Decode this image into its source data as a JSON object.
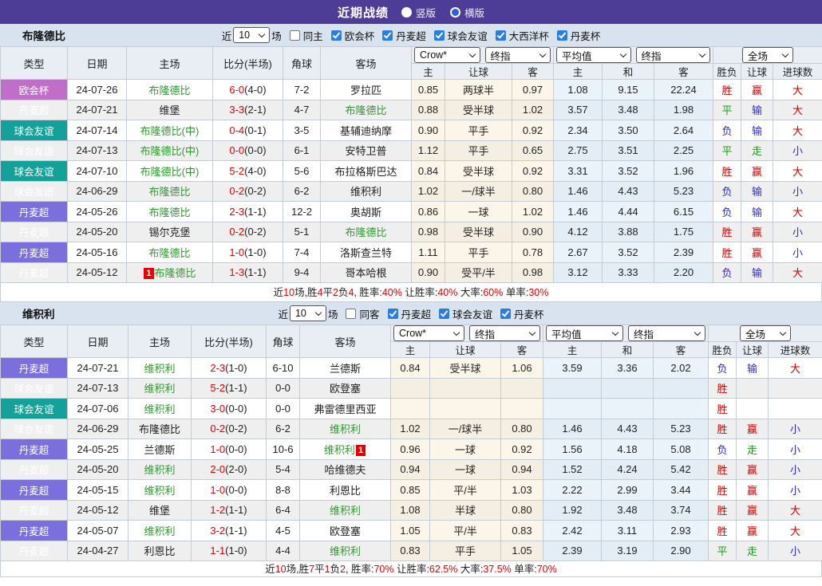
{
  "topbar": {
    "title": "近期战绩",
    "radios": [
      {
        "label": "竖版",
        "variant": "solid"
      },
      {
        "label": "横版",
        "variant": "dot"
      }
    ]
  },
  "colors": {
    "topbar_bg": "#4e3d96",
    "sectionbar_bg": "#d9e3ef",
    "header_bg": "#e9edf4",
    "border_c": "#c6ccd6",
    "badge_cup": "#c06fc8",
    "badge_super": "#7b6fde",
    "badge_friendly": "#13a19a",
    "team_green": "#2f9b2f",
    "score_red": "#e60000",
    "res_red": "#d30000",
    "res_blue": "#2b2bd5",
    "res_green": "#18a018",
    "row_alt": "#efefef",
    "odds_bg": "#fcf6ea",
    "odds_bg_alt": "#f5efe3",
    "avg_bg": "#eaf3fa",
    "avg_bg_alt": "#e3edf5",
    "accent_blue": "#2a7de1",
    "radio_dot": "#2a62d8",
    "summary_red": "#e60000",
    "card_red": "#e60000"
  },
  "league_class": {
    "欧会杯": "cup",
    "丹麦超": "super",
    "球会友谊": "friendly"
  },
  "result_color_map": {
    "胜": "red",
    "平": "green",
    "负": "blue",
    "赢": "red",
    "输": "blue",
    "走": "green",
    "大": "red",
    "小": "blue"
  },
  "sections": [
    {
      "team": "布隆德比",
      "filter": {
        "prefix": "近",
        "count": "10",
        "suffix": "场",
        "venue": {
          "label": "同主",
          "checked": false
        },
        "leagues": [
          {
            "label": "欧会杯",
            "checked": true
          },
          {
            "label": "丹麦超",
            "checked": true
          },
          {
            "label": "球会友谊",
            "checked": true
          },
          {
            "label": "大西洋杯",
            "checked": true
          },
          {
            "label": "丹麦杯",
            "checked": true
          }
        ]
      },
      "header": {
        "left_cols": [
          "类型",
          "日期",
          "主场",
          "比分(半场)",
          "角球",
          "客场"
        ],
        "odds_selects": [
          "Crow*",
          "终指"
        ],
        "avg_selects": [
          "平均值",
          "终指"
        ],
        "scope_select": "全场",
        "sub_cols": [
          "主",
          "让球",
          "客",
          "主",
          "和",
          "客",
          "胜负",
          "让球",
          "进球数"
        ]
      },
      "rows": [
        {
          "league": "欧会杯",
          "date": "24-07-26",
          "home": {
            "name": "布隆德比",
            "green": true
          },
          "score": "6-0",
          "half": "(4-0)",
          "corners": "7-2",
          "away": {
            "name": "罗拉匹",
            "green": false
          },
          "odds": [
            "0.85",
            "两球半",
            "0.97"
          ],
          "avg": [
            "1.08",
            "9.15",
            "22.24"
          ],
          "results": [
            "胜",
            "赢",
            "大"
          ]
        },
        {
          "league": "丹麦超",
          "date": "24-07-21",
          "home": {
            "name": "维堡",
            "green": false
          },
          "score": "3-3",
          "half": "(2-1)",
          "corners": "4-7",
          "away": {
            "name": "布隆德比",
            "green": true
          },
          "odds": [
            "0.88",
            "受半球",
            "1.02"
          ],
          "avg": [
            "3.57",
            "3.48",
            "1.98"
          ],
          "results": [
            "平",
            "输",
            "大"
          ]
        },
        {
          "league": "球会友谊",
          "date": "24-07-14",
          "home": {
            "name": "布隆德比(中)",
            "green": true
          },
          "score": "0-4",
          "half": "(0-1)",
          "corners": "3-5",
          "away": {
            "name": "基辅迪纳摩",
            "green": false
          },
          "odds": [
            "0.90",
            "平手",
            "0.92"
          ],
          "avg": [
            "2.34",
            "3.50",
            "2.64"
          ],
          "results": [
            "负",
            "输",
            "大"
          ]
        },
        {
          "league": "球会友谊",
          "date": "24-07-13",
          "home": {
            "name": "布隆德比(中)",
            "green": true
          },
          "score": "0-0",
          "half": "(0-0)",
          "corners": "6-1",
          "away": {
            "name": "安特卫普",
            "green": false
          },
          "odds": [
            "1.12",
            "平手",
            "0.65"
          ],
          "avg": [
            "2.75",
            "3.51",
            "2.25"
          ],
          "results": [
            "平",
            "走",
            "小"
          ]
        },
        {
          "league": "球会友谊",
          "date": "24-07-10",
          "home": {
            "name": "布隆德比(中)",
            "green": true
          },
          "score": "5-2",
          "half": "(4-0)",
          "corners": "5-6",
          "away": {
            "name": "布拉格斯巴达",
            "green": false
          },
          "odds": [
            "0.84",
            "受半球",
            "0.92"
          ],
          "avg": [
            "3.31",
            "3.52",
            "1.96"
          ],
          "results": [
            "胜",
            "赢",
            "大"
          ]
        },
        {
          "league": "球会友谊",
          "date": "24-06-29",
          "home": {
            "name": "布隆德比",
            "green": true
          },
          "score": "0-2",
          "half": "(0-2)",
          "corners": "6-2",
          "away": {
            "name": "维积利",
            "green": false
          },
          "odds": [
            "1.02",
            "一/球半",
            "0.80"
          ],
          "avg": [
            "1.46",
            "4.43",
            "5.23"
          ],
          "results": [
            "负",
            "输",
            "小"
          ]
        },
        {
          "league": "丹麦超",
          "date": "24-05-26",
          "home": {
            "name": "布隆德比",
            "green": true
          },
          "score": "2-3",
          "half": "(1-1)",
          "corners": "12-2",
          "away": {
            "name": "奥胡斯",
            "green": false
          },
          "odds": [
            "0.86",
            "一球",
            "1.02"
          ],
          "avg": [
            "1.46",
            "4.44",
            "6.15"
          ],
          "results": [
            "负",
            "输",
            "大"
          ]
        },
        {
          "league": "丹麦超",
          "date": "24-05-20",
          "home": {
            "name": "锡尔克堡",
            "green": false
          },
          "score": "0-2",
          "half": "(0-2)",
          "corners": "5-1",
          "away": {
            "name": "布隆德比",
            "green": true
          },
          "odds": [
            "0.98",
            "受半球",
            "0.90"
          ],
          "avg": [
            "4.12",
            "3.88",
            "1.75"
          ],
          "results": [
            "胜",
            "赢",
            "小"
          ]
        },
        {
          "league": "丹麦超",
          "date": "24-05-16",
          "home": {
            "name": "布隆德比",
            "green": true
          },
          "score": "1-0",
          "half": "(1-0)",
          "corners": "7-4",
          "away": {
            "name": "洛斯查兰特",
            "green": false
          },
          "odds": [
            "1.11",
            "平手",
            "0.78"
          ],
          "avg": [
            "2.67",
            "3.52",
            "2.39"
          ],
          "results": [
            "胜",
            "赢",
            "小"
          ]
        },
        {
          "league": "丹麦超",
          "date": "24-05-12",
          "home": {
            "name": "布隆德比",
            "green": true,
            "card": "1",
            "card_pos": "before"
          },
          "score": "1-3",
          "half": "(1-1)",
          "corners": "9-4",
          "away": {
            "name": "哥本哈根",
            "green": false
          },
          "odds": [
            "0.90",
            "受平/半",
            "0.98"
          ],
          "avg": [
            "3.12",
            "3.33",
            "2.20"
          ],
          "results": [
            "负",
            "输",
            "大"
          ]
        }
      ],
      "summary": [
        {
          "t": "近"
        },
        {
          "t": "10",
          "red": true
        },
        {
          "t": "场,胜"
        },
        {
          "t": "4",
          "red": true
        },
        {
          "t": "平"
        },
        {
          "t": "2",
          "red": true
        },
        {
          "t": "负"
        },
        {
          "t": "4",
          "red": true
        },
        {
          "t": ", 胜率:"
        },
        {
          "t": "40%",
          "red": true
        },
        {
          "t": " 让胜率:"
        },
        {
          "t": "40%",
          "red": true
        },
        {
          "t": " 大率:"
        },
        {
          "t": "60%",
          "red": true
        },
        {
          "t": " 单率:"
        },
        {
          "t": "30%",
          "red": true
        }
      ]
    },
    {
      "team": "维积利",
      "filter": {
        "prefix": "近",
        "count": "10",
        "suffix": "场",
        "venue": {
          "label": "同客",
          "checked": false
        },
        "leagues": [
          {
            "label": "丹麦超",
            "checked": true
          },
          {
            "label": "球会友谊",
            "checked": true
          },
          {
            "label": "丹麦杯",
            "checked": true
          }
        ]
      },
      "header": {
        "left_cols": [
          "类型",
          "日期",
          "主场",
          "比分(半场)",
          "角球",
          "客场"
        ],
        "odds_selects": [
          "Crow*",
          "终指"
        ],
        "avg_selects": [
          "平均值",
          "终指"
        ],
        "scope_select": "全场",
        "sub_cols": [
          "主",
          "让球",
          "客",
          "主",
          "和",
          "客",
          "胜负",
          "让球",
          "进球数"
        ]
      },
      "rows": [
        {
          "league": "丹麦超",
          "date": "24-07-21",
          "home": {
            "name": "维积利",
            "green": true
          },
          "score": "2-3",
          "half": "(1-0)",
          "corners": "6-10",
          "away": {
            "name": "兰德斯",
            "green": false
          },
          "odds": [
            "0.84",
            "受半球",
            "1.06"
          ],
          "avg": [
            "3.59",
            "3.36",
            "2.02"
          ],
          "results": [
            "负",
            "输",
            "大"
          ]
        },
        {
          "league": "球会友谊",
          "date": "24-07-13",
          "home": {
            "name": "维积利",
            "green": true
          },
          "score": "5-2",
          "half": "(1-1)",
          "corners": "0-0",
          "away": {
            "name": "欧登塞",
            "green": false
          },
          "odds": [
            "",
            "",
            ""
          ],
          "avg": [
            "",
            "",
            ""
          ],
          "results": [
            "胜",
            "",
            ""
          ]
        },
        {
          "league": "球会友谊",
          "date": "24-07-06",
          "home": {
            "name": "维积利",
            "green": true
          },
          "score": "3-0",
          "half": "(0-0)",
          "corners": "0-0",
          "away": {
            "name": "弗雷德里西亚",
            "green": false
          },
          "odds": [
            "",
            "",
            ""
          ],
          "avg": [
            "",
            "",
            ""
          ],
          "results": [
            "胜",
            "",
            ""
          ]
        },
        {
          "league": "球会友谊",
          "date": "24-06-29",
          "home": {
            "name": "布隆德比",
            "green": false
          },
          "score": "0-2",
          "half": "(0-2)",
          "corners": "6-2",
          "away": {
            "name": "维积利",
            "green": true
          },
          "odds": [
            "1.02",
            "一/球半",
            "0.80"
          ],
          "avg": [
            "1.46",
            "4.43",
            "5.23"
          ],
          "results": [
            "胜",
            "赢",
            "小"
          ]
        },
        {
          "league": "丹麦超",
          "date": "24-05-25",
          "home": {
            "name": "兰德斯",
            "green": false
          },
          "score": "1-0",
          "half": "(0-0)",
          "corners": "10-6",
          "away": {
            "name": "维积利",
            "green": true,
            "card": "1",
            "card_pos": "after"
          },
          "odds": [
            "0.96",
            "一球",
            "0.92"
          ],
          "avg": [
            "1.56",
            "4.18",
            "5.08"
          ],
          "results": [
            "负",
            "走",
            "小"
          ]
        },
        {
          "league": "丹麦超",
          "date": "24-05-20",
          "home": {
            "name": "维积利",
            "green": true
          },
          "score": "2-0",
          "half": "(2-0)",
          "corners": "5-4",
          "away": {
            "name": "哈维德夫",
            "green": false
          },
          "odds": [
            "0.94",
            "一球",
            "0.94"
          ],
          "avg": [
            "1.52",
            "4.24",
            "5.42"
          ],
          "results": [
            "胜",
            "赢",
            "小"
          ]
        },
        {
          "league": "丹麦超",
          "date": "24-05-15",
          "home": {
            "name": "维积利",
            "green": true
          },
          "score": "1-0",
          "half": "(0-0)",
          "corners": "8-8",
          "away": {
            "name": "利恩比",
            "green": false
          },
          "odds": [
            "0.85",
            "平/半",
            "1.03"
          ],
          "avg": [
            "2.22",
            "2.99",
            "3.44"
          ],
          "results": [
            "胜",
            "赢",
            "小"
          ]
        },
        {
          "league": "丹麦超",
          "date": "24-05-12",
          "home": {
            "name": "维堡",
            "green": false
          },
          "score": "1-2",
          "half": "(1-1)",
          "corners": "6-4",
          "away": {
            "name": "维积利",
            "green": true
          },
          "odds": [
            "1.08",
            "半球",
            "0.80"
          ],
          "avg": [
            "1.92",
            "3.48",
            "3.74"
          ],
          "results": [
            "胜",
            "赢",
            "大"
          ]
        },
        {
          "league": "丹麦超",
          "date": "24-05-07",
          "home": {
            "name": "维积利",
            "green": true
          },
          "score": "3-2",
          "half": "(1-1)",
          "corners": "4-5",
          "away": {
            "name": "欧登塞",
            "green": false
          },
          "odds": [
            "1.05",
            "平/半",
            "0.83"
          ],
          "avg": [
            "2.42",
            "3.11",
            "2.93"
          ],
          "results": [
            "胜",
            "赢",
            "大"
          ]
        },
        {
          "league": "丹麦超",
          "date": "24-04-27",
          "home": {
            "name": "利恩比",
            "green": false
          },
          "score": "1-1",
          "half": "(1-0)",
          "corners": "4-4",
          "away": {
            "name": "维积利",
            "green": true
          },
          "odds": [
            "0.83",
            "平手",
            "1.05"
          ],
          "avg": [
            "2.39",
            "3.19",
            "2.90"
          ],
          "results": [
            "平",
            "走",
            "小"
          ]
        }
      ],
      "summary": [
        {
          "t": "近"
        },
        {
          "t": "10",
          "red": true
        },
        {
          "t": "场,胜"
        },
        {
          "t": "7",
          "red": true
        },
        {
          "t": "平"
        },
        {
          "t": "1",
          "red": true
        },
        {
          "t": "负"
        },
        {
          "t": "2",
          "red": true
        },
        {
          "t": ", 胜率:"
        },
        {
          "t": "70%",
          "red": true
        },
        {
          "t": " 让胜率:"
        },
        {
          "t": "62.5%",
          "red": true
        },
        {
          "t": " 大率:"
        },
        {
          "t": "37.5%",
          "red": true
        },
        {
          "t": " 单率:"
        },
        {
          "t": "70%",
          "red": true
        }
      ]
    }
  ]
}
